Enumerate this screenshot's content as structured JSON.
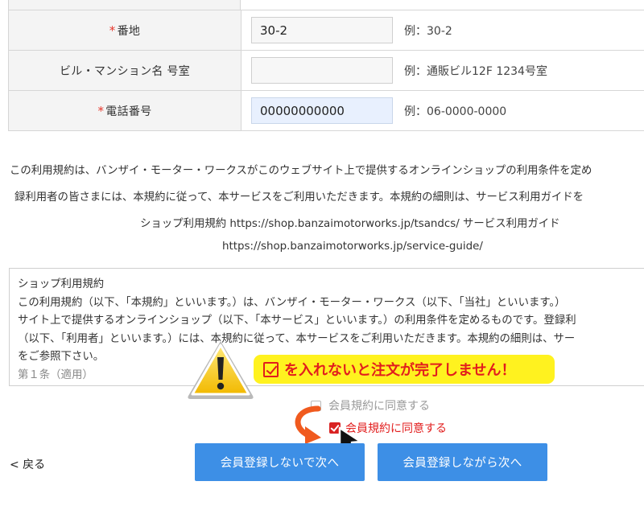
{
  "form": {
    "rows": [
      {
        "required": true,
        "label": "番地",
        "value": "30-2",
        "example": "例：30-2"
      },
      {
        "required": false,
        "label": "ビル・マンション名 号室",
        "value": "",
        "example": "例：通販ビル12F 1234号室"
      },
      {
        "required": true,
        "label": "電話番号",
        "value": "00000000000",
        "example": "例：06-0000-0000"
      }
    ],
    "required_mark": "*"
  },
  "terms_intro": {
    "line1": "この利用規約は、バンザイ・モーター・ワークスがこのウェブサイト上で提供するオンラインショップの利用条件を定め",
    "line2": "録利用者の皆さまには、本規約に従って、本サービスをご利用いただきます。本規約の細則は、サービス利用ガイドを",
    "line3": "ショップ利用規約 https://shop.banzaimotorworks.jp/tsandcs/ サービス利用ガイド",
    "line4": "https://shop.banzaimotorworks.jp/service-guide/"
  },
  "terms_box": {
    "lines": [
      "ショップ利用規約",
      "この利用規約（以下、「本規約」といいます。）は、バンザイ・モーター・ワークス（以下、「当社」といいます。）",
      "サイト上で提供するオンラインショップ（以下、「本サービス」といいます。）の利用条件を定めるものです。登録利",
      "（以下、「利用者」といいます。）には、本規約に従って、本サービスをご利用いただきます。本規約の細則は、サー",
      "をご参照下さい。"
    ],
    "partial_line": "第１条（適用）"
  },
  "callout": {
    "text": "を入れないと注文が完了しません！",
    "colors": {
      "bubble": "#fff21f",
      "text": "#e21d1d"
    }
  },
  "agree": {
    "ghost_label": "会員規約に同意する",
    "checked_label": "会員規約に同意する",
    "checked": true
  },
  "nav": {
    "back_label": "< 戻る"
  },
  "buttons": {
    "guest_label": "会員登録しないで次へ",
    "register_label": "会員登録しながら次へ",
    "color": "#3d8fe6"
  },
  "icons": [
    "warning-icon",
    "curved-arrow-icon",
    "cursor-arrow-icon",
    "checkbox-icon"
  ]
}
